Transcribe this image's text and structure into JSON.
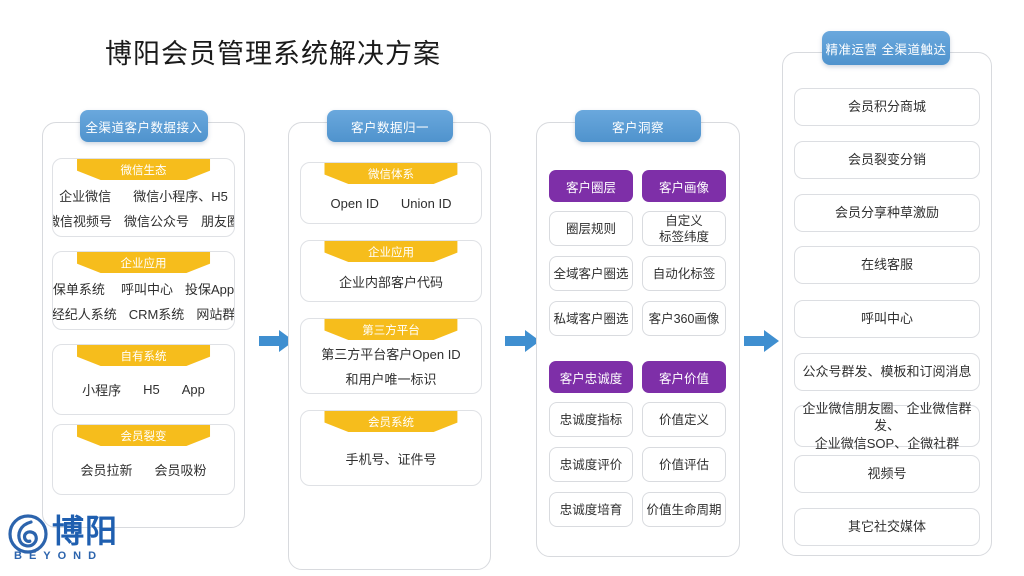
{
  "title": "博阳会员管理系统解决方案",
  "logo": {
    "cn": "博阳",
    "en": "BEYOND"
  },
  "colors": {
    "badge_blue": "#4f93cd",
    "banner_yellow": "#f6bd1c",
    "purple": "#7e2fa8",
    "arrow_blue": "#3f8fd0",
    "panel_border": "#d8dade",
    "title_text": "#1a1a1a"
  },
  "columns": [
    {
      "badge": "全渠道客户数据接入",
      "cards": [
        {
          "banner": "微信生态",
          "lines": [
            [
              "企业微信",
              "微信小程序、H5"
            ],
            [
              "微信视频号",
              "微信公众号",
              "朋友圈"
            ]
          ]
        },
        {
          "banner": "企业应用",
          "lines": [
            [
              "保单系统",
              "呼叫中心",
              "投保App"
            ],
            [
              "经纪人系统",
              "CRM系统",
              "网站群"
            ]
          ]
        },
        {
          "banner": "自有系统",
          "lines": [
            [
              "小程序",
              "H5",
              "App"
            ]
          ]
        },
        {
          "banner": "会员裂变",
          "lines": [
            [
              "会员拉新",
              "会员吸粉"
            ]
          ]
        }
      ]
    },
    {
      "badge": "客户数据归一",
      "cards": [
        {
          "banner": "微信体系",
          "lines": [
            [
              "Open ID",
              "Union ID"
            ]
          ]
        },
        {
          "banner": "企业应用",
          "lines": [
            [
              "企业内部客户代码"
            ]
          ]
        },
        {
          "banner": "第三方平台",
          "lines": [
            [
              "第三方平台客户Open  ID"
            ],
            [
              "和用户唯一标识"
            ]
          ]
        },
        {
          "banner": "会员系统",
          "lines": [
            [
              "手机号、证件号"
            ]
          ]
        }
      ]
    },
    {
      "badge": "客户洞察",
      "groups": [
        {
          "left_header": "客户圈层",
          "right_header": "客户画像",
          "left_items": [
            "圈层规则",
            "全域客户圈选",
            "私域客户圈选"
          ],
          "right_items": [
            "自定义\n标签纬度",
            "自动化标签",
            "客户360画像"
          ]
        },
        {
          "left_header": "客户忠诚度",
          "right_header": "客户价值",
          "left_items": [
            "忠诚度指标",
            "忠诚度评价",
            "忠诚度培育"
          ],
          "right_items": [
            "价值定义",
            "价值评估",
            "价值生命周期"
          ]
        }
      ]
    },
    {
      "badge": "精准运营 全渠道触达",
      "rows": [
        "会员积分商城",
        "会员裂变分销",
        "会员分享种草激励",
        "在线客服",
        "呼叫中心",
        "公众号群发、模板和订阅消息",
        "企业微信朋友圈、企业微信群发、\n企业微信SOP、企微社群",
        "视频号",
        "其它社交媒体"
      ]
    }
  ],
  "arrows": [
    "arrow-right-icon",
    "arrow-right-icon",
    "arrow-right-icon"
  ]
}
